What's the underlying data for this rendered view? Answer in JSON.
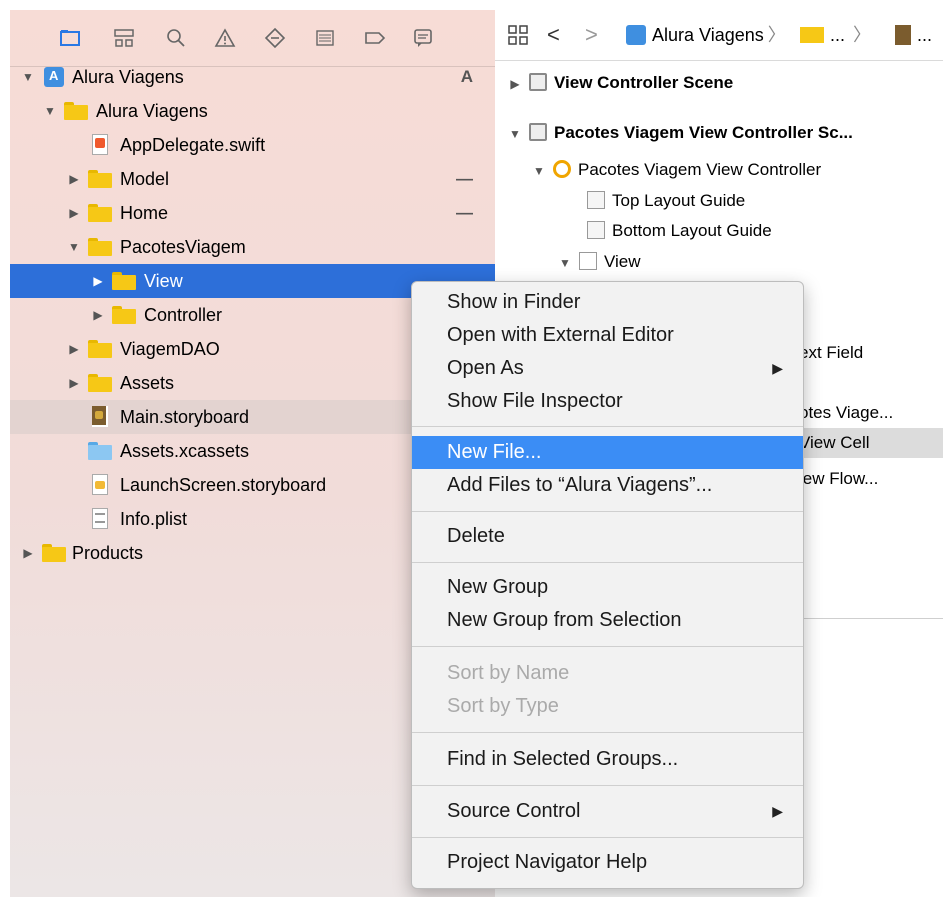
{
  "navigator": {
    "toolbar_icons": [
      "folder-icon",
      "hierarchy-icon",
      "search-icon",
      "warning-icon",
      "test-diamond-icon",
      "debug-list-icon",
      "breakpoint-icon",
      "report-icon"
    ],
    "rows": [
      {
        "label": "Alura Viagens",
        "badge": "A",
        "expanded": true
      },
      {
        "label": "Alura Viagens",
        "expanded": true
      },
      {
        "label": "AppDelegate.swift"
      },
      {
        "label": "Model",
        "badge": "—"
      },
      {
        "label": "Home",
        "badge": "—"
      },
      {
        "label": "PacotesViagem",
        "expanded": true
      },
      {
        "label": "View",
        "selected": true
      },
      {
        "label": "Controller"
      },
      {
        "label": "ViagemDAO"
      },
      {
        "label": "Assets"
      },
      {
        "label": "Main.storyboard"
      },
      {
        "label": "Assets.xcassets"
      },
      {
        "label": "LaunchScreen.storyboard"
      },
      {
        "label": "Info.plist"
      },
      {
        "label": "Products"
      }
    ]
  },
  "jumpbar": {
    "grid_icon": "related-items-icon",
    "back": "<",
    "forward": ">",
    "crumb1": "Alura Viagens",
    "crumb2": "...",
    "crumb3": "..."
  },
  "outline": {
    "scene1": "View Controller Scene",
    "scene2": "Pacotes Viagem View Controller Sc...",
    "vc": "Pacotes Viagem View Controller",
    "top_guide": "Top Layout Guide",
    "bottom_guide": "Bottom Layout Guide",
    "view": "View",
    "text_field": "ext Field",
    "pacotes": "otes Viage...",
    "cell": "View Cell",
    "flow": "iew Flow..."
  },
  "context_menu": {
    "items": {
      "show_in_finder": "Show in Finder",
      "open_external": "Open with External Editor",
      "open_as": "Open As",
      "show_inspector": "Show File Inspector",
      "new_file": "New File...",
      "add_files": "Add Files to “Alura Viagens”...",
      "delete": "Delete",
      "new_group": "New Group",
      "new_group_selection": "New Group from Selection",
      "sort_name": "Sort by Name",
      "sort_type": "Sort by Type",
      "find_groups": "Find in Selected Groups...",
      "source_control": "Source Control",
      "help": "Project Navigator Help"
    },
    "submenu_arrow": "▶",
    "highlight_color": "#3b8df5"
  },
  "colors": {
    "selection": "#2d6fd9",
    "navigator_bg": "#f7dcd6",
    "folder": "#f6c816"
  }
}
